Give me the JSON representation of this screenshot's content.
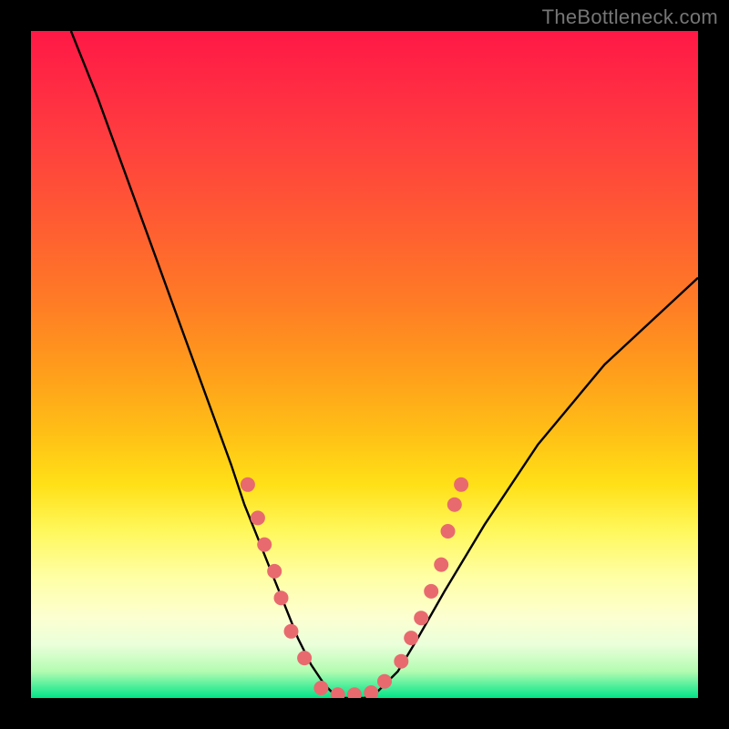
{
  "watermark": {
    "text": "TheBottleneck.com"
  },
  "chart_data": {
    "type": "line",
    "title": "",
    "xlabel": "",
    "ylabel": "",
    "xlim": [
      0,
      100
    ],
    "ylim": [
      0,
      100
    ],
    "grid": false,
    "series": [
      {
        "name": "curve",
        "x": [
          6,
          10,
          14,
          18,
          22,
          26,
          30,
          32,
          34,
          36,
          38,
          40,
          42,
          44,
          46,
          48,
          50,
          52,
          55,
          58,
          62,
          68,
          76,
          86,
          100
        ],
        "y": [
          100,
          90,
          79,
          68,
          57,
          46,
          35,
          29,
          24,
          19,
          14,
          9,
          5,
          2,
          0,
          0,
          0,
          1,
          4,
          9,
          16,
          26,
          38,
          50,
          63
        ]
      }
    ],
    "markers": {
      "name": "dots",
      "color": "#e86a6f",
      "radius": 8,
      "points": [
        {
          "x": 32.5,
          "y": 32
        },
        {
          "x": 34.0,
          "y": 27
        },
        {
          "x": 35.0,
          "y": 23
        },
        {
          "x": 36.5,
          "y": 19
        },
        {
          "x": 37.5,
          "y": 15
        },
        {
          "x": 39.0,
          "y": 10
        },
        {
          "x": 41.0,
          "y": 6
        },
        {
          "x": 43.5,
          "y": 1.5
        },
        {
          "x": 46.0,
          "y": 0.5
        },
        {
          "x": 48.5,
          "y": 0.5
        },
        {
          "x": 51.0,
          "y": 0.8
        },
        {
          "x": 53.0,
          "y": 2.5
        },
        {
          "x": 55.5,
          "y": 5.5
        },
        {
          "x": 57.0,
          "y": 9
        },
        {
          "x": 58.5,
          "y": 12
        },
        {
          "x": 60.0,
          "y": 16
        },
        {
          "x": 61.5,
          "y": 20
        },
        {
          "x": 62.5,
          "y": 25
        },
        {
          "x": 63.5,
          "y": 29
        },
        {
          "x": 64.5,
          "y": 32
        }
      ]
    }
  }
}
